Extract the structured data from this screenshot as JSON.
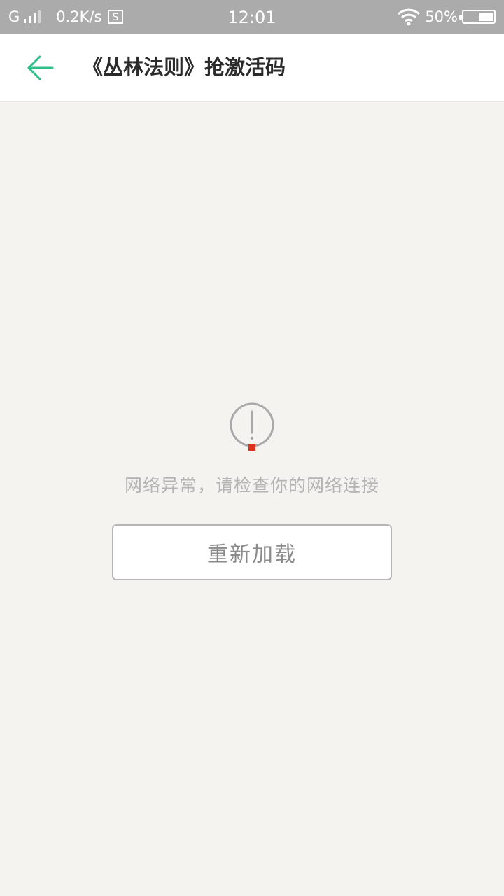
{
  "status_bar": {
    "network_type": "G",
    "speed": "0.2K/s",
    "time": "12:01",
    "battery_percent": "50%",
    "battery_level": 0.5
  },
  "header": {
    "title": "《丛林法则》抢激活码",
    "back_icon": "arrow-left-icon",
    "accent_color": "#2fc08a"
  },
  "error_view": {
    "icon": "alert-circle-icon",
    "message": "网络异常，请检查你的网络连接",
    "reload_label": "重新加载"
  }
}
